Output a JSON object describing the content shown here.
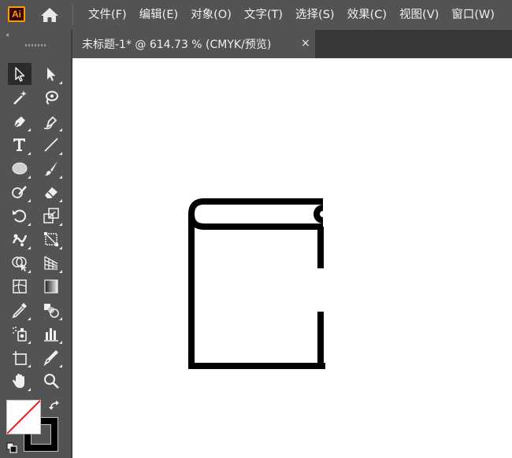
{
  "app": {
    "logo_text": "Ai"
  },
  "menu": {
    "items": [
      "文件(F)",
      "编辑(E)",
      "对象(O)",
      "文字(T)",
      "选择(S)",
      "效果(C)",
      "视图(V)",
      "窗口(W)"
    ]
  },
  "document_tab": {
    "title": "未标题-1* @ 614.73 % (CMYK/预览)",
    "close_glyph": "×"
  },
  "toolbar": {
    "collapse_glyph": "‹‹",
    "tools": [
      "selection-tool",
      "direct-selection-tool",
      "magic-wand-tool",
      "lasso-tool",
      "pen-tool",
      "curvature-tool",
      "type-tool",
      "line-segment-tool",
      "ellipse-tool",
      "paintbrush-tool",
      "shaper-tool",
      "eraser-tool",
      "rotate-tool",
      "scale-tool",
      "puppet-warp-tool",
      "free-transform-tool",
      "shape-builder-tool",
      "perspective-grid-tool",
      "mesh-tool",
      "gradient-tool",
      "eyedropper-tool",
      "blend-tool",
      "symbol-sprayer-tool",
      "column-graph-tool",
      "artboard-tool",
      "slice-tool",
      "hand-tool",
      "zoom-tool"
    ],
    "active_tool": "selection-tool",
    "fill": "none",
    "stroke": "#000000"
  },
  "colors": {
    "ui_background": "#535353",
    "tab_bar": "#383838",
    "canvas": "#ffffff",
    "artwork_stroke": "#000000",
    "logo_accent": "#ff9a00",
    "none_slash": "#e02020"
  }
}
